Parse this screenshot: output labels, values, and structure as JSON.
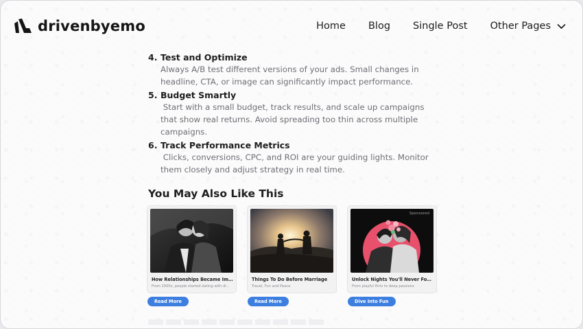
{
  "brand": {
    "name": "drivenbyemo"
  },
  "nav": {
    "items": [
      {
        "label": "Home"
      },
      {
        "label": "Blog"
      },
      {
        "label": "Single Post"
      },
      {
        "label": "Other Pages"
      }
    ]
  },
  "article": {
    "steps": [
      {
        "number": "4.",
        "title": "Test and Optimize",
        "body": "Always A/B test different versions of your ads. Small changes in headline, CTA, or image can significantly impact performance."
      },
      {
        "number": "5.",
        "title": "Budget Smartly",
        "body": " Start with a small budget, track results, and scale up campaigns that show real returns. Avoid spreading too thin across multiple campaigns."
      },
      {
        "number": "6.",
        "title": "Track Performance Metrics",
        "body": " Clicks, conversions, CPC, and ROI are your guiding lights. Monitor them closely and adjust strategy in real time."
      }
    ]
  },
  "related": {
    "heading": "You May Also Like This",
    "cards": [
      {
        "title": "How Relationships Became Impo...",
        "subtitle": "From 2000s, people started dating with di...",
        "button": "Read More"
      },
      {
        "title": "Things To Do Before Marriage",
        "subtitle": "Travel, Fun and Peace",
        "button": "Read More"
      },
      {
        "title": "Unlock Nights You'll Never Forget",
        "subtitle": "From playful flirts to deep passions",
        "button": "Dive Into Fun",
        "badge": "Sponsored"
      }
    ]
  },
  "colors": {
    "accent": "#3d7fe0",
    "text_muted": "#6f6f74",
    "sponsored_circle": "#e8506b"
  }
}
